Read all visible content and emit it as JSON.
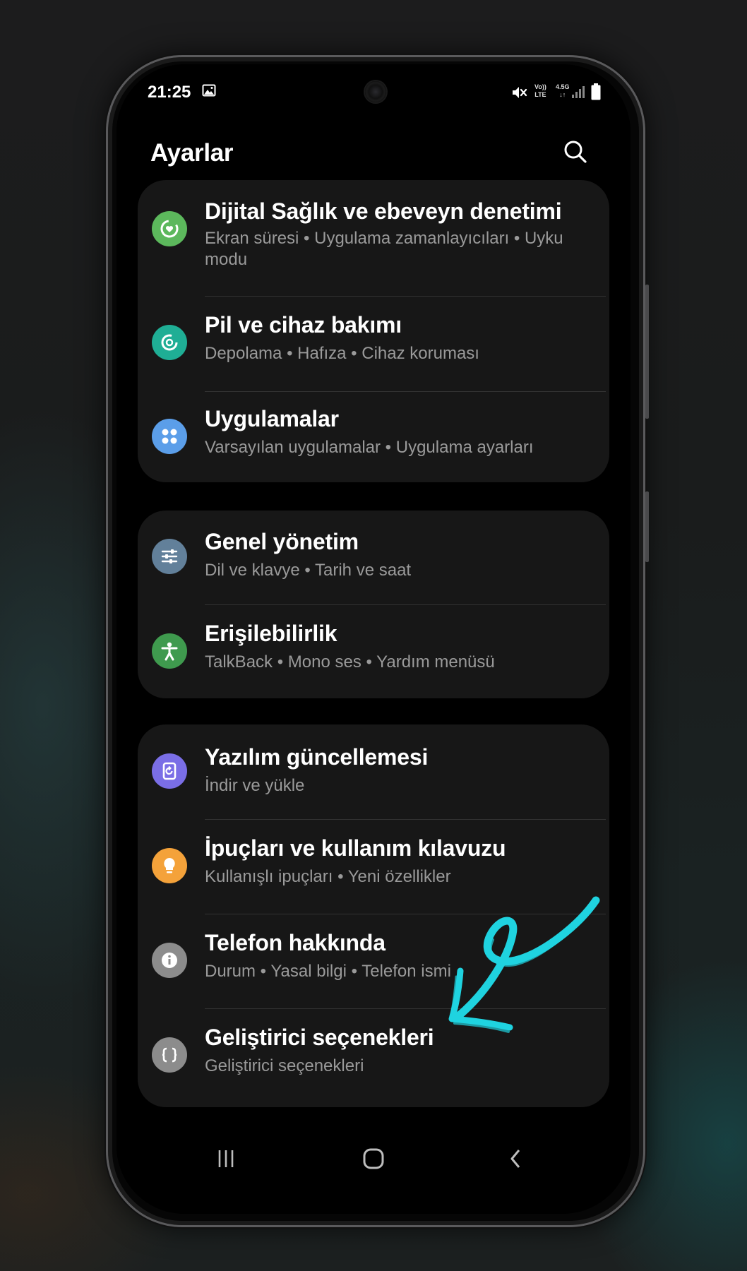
{
  "status_bar": {
    "time": "21:25",
    "network_volte": "Vo))",
    "network_lte": "LTE",
    "network_gen": "4.5G",
    "icons": [
      "gallery-icon",
      "mute-icon",
      "signal-icon",
      "battery-icon"
    ]
  },
  "header": {
    "title": "Ayarlar",
    "search_icon": "search-icon"
  },
  "groups": [
    {
      "items": [
        {
          "title": "Dijital Sağlık ve ebeveyn denetimi",
          "subtitle": "Ekran süresi  •  Uygulama zamanlayıcıları  •  Uyku modu",
          "icon": "digital-wellbeing-icon",
          "icon_color": "#5cb85c"
        },
        {
          "title": "Pil ve cihaz bakımı",
          "subtitle": "Depolama  •  Hafıza  •  Cihaz koruması",
          "icon": "device-care-icon",
          "icon_color": "#1fae95"
        },
        {
          "title": "Uygulamalar",
          "subtitle": "Varsayılan uygulamalar  •  Uygulama ayarları",
          "icon": "apps-icon",
          "icon_color": "#5b9ee9"
        }
      ]
    },
    {
      "items": [
        {
          "title": "Genel yönetim",
          "subtitle": "Dil ve klavye  •  Tarih ve saat",
          "icon": "general-management-icon",
          "icon_color": "#62809a"
        },
        {
          "title": "Erişilebilirlik",
          "subtitle": "TalkBack  •  Mono ses  •  Yardım menüsü",
          "icon": "accessibility-icon",
          "icon_color": "#3f9a4e"
        }
      ]
    },
    {
      "items": [
        {
          "title": "Yazılım güncellemesi",
          "subtitle": "İndir ve yükle",
          "icon": "software-update-icon",
          "icon_color": "#7a6ee6"
        },
        {
          "title": "İpuçları ve kullanım kılavuzu",
          "subtitle": "Kullanışlı ipuçları  •  Yeni özellikler",
          "icon": "tips-icon",
          "icon_color": "#f4a23a"
        },
        {
          "title": "Telefon hakkında",
          "subtitle": "Durum  •  Yasal bilgi  •  Telefon ismi",
          "icon": "info-icon",
          "icon_color": "#8c8c8c"
        },
        {
          "title": "Geliştirici seçenekleri",
          "subtitle": "Geliştirici seçenekleri",
          "icon": "developer-options-icon",
          "icon_color": "#8c8c8c"
        }
      ]
    }
  ],
  "nav_bar": {
    "buttons": [
      "recents-icon",
      "home-icon",
      "back-icon"
    ]
  },
  "annotation": {
    "color": "#1fd3e0",
    "target": "Geliştirici seçenekleri"
  }
}
